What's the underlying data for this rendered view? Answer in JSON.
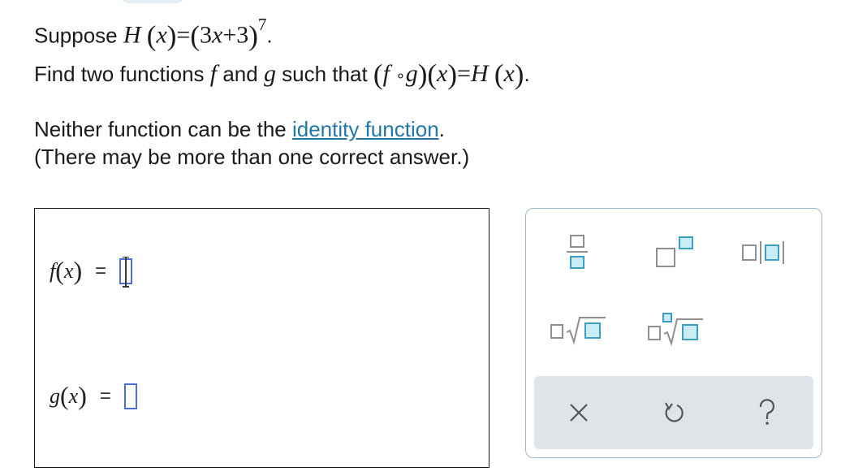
{
  "problem": {
    "line1_prefix": "Suppose ",
    "H_func": "H",
    "var_x": "x",
    "eq_sign": "=",
    "inner_three": "3",
    "inner_plus": "+",
    "inner_const": "3",
    "exponent": "7",
    "period": ".",
    "line2_prefix": "Find two functions ",
    "f_name": "f",
    "and_text": " and ",
    "g_name": "g",
    "such_that": " such that ",
    "compose_op": "∘",
    "line3_prefix": "Neither function can be the ",
    "identity_link": "identity function",
    "line4": "(There may be more than one correct answer.)"
  },
  "answer": {
    "f_label": "f",
    "g_label": "g",
    "var": "x",
    "equals": "=",
    "f_value": "",
    "g_value": ""
  },
  "palette": {
    "buttons": [
      "fraction-button",
      "superscript-button",
      "absolute-value-button",
      "square-root-button",
      "nth-root-button"
    ],
    "tools": [
      "clear-button",
      "undo-button",
      "help-button"
    ],
    "accent_color": "#3a9fc4"
  }
}
